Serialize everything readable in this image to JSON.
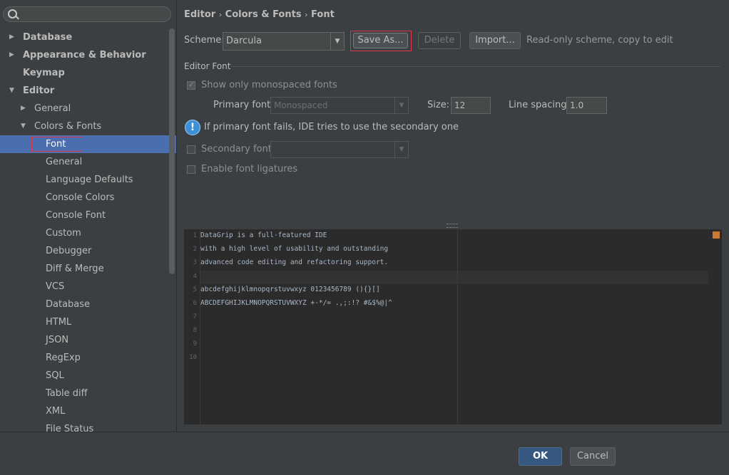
{
  "search": {
    "placeholder": ""
  },
  "sidebar": {
    "items": [
      {
        "label": "Database",
        "level": 0,
        "arrow": "▶",
        "bold": true
      },
      {
        "label": "Appearance & Behavior",
        "level": 0,
        "arrow": "▶",
        "bold": true
      },
      {
        "label": "Keymap",
        "level": 0,
        "arrow": "",
        "bold": true
      },
      {
        "label": "Editor",
        "level": 0,
        "arrow": "▼",
        "bold": true
      },
      {
        "label": "General",
        "level": 1,
        "arrow": "▶"
      },
      {
        "label": "Colors & Fonts",
        "level": 1,
        "arrow": "▼"
      },
      {
        "label": "Font",
        "level": 2,
        "arrow": "",
        "selected": true
      },
      {
        "label": "General",
        "level": 2,
        "arrow": ""
      },
      {
        "label": "Language Defaults",
        "level": 2,
        "arrow": ""
      },
      {
        "label": "Console Colors",
        "level": 2,
        "arrow": ""
      },
      {
        "label": "Console Font",
        "level": 2,
        "arrow": ""
      },
      {
        "label": "Custom",
        "level": 2,
        "arrow": ""
      },
      {
        "label": "Debugger",
        "level": 2,
        "arrow": ""
      },
      {
        "label": "Diff & Merge",
        "level": 2,
        "arrow": ""
      },
      {
        "label": "VCS",
        "level": 2,
        "arrow": ""
      },
      {
        "label": "Database",
        "level": 2,
        "arrow": ""
      },
      {
        "label": "HTML",
        "level": 2,
        "arrow": ""
      },
      {
        "label": "JSON",
        "level": 2,
        "arrow": ""
      },
      {
        "label": "RegExp",
        "level": 2,
        "arrow": ""
      },
      {
        "label": "SQL",
        "level": 2,
        "arrow": ""
      },
      {
        "label": "Table diff",
        "level": 2,
        "arrow": ""
      },
      {
        "label": "XML",
        "level": 2,
        "arrow": ""
      },
      {
        "label": "File Status",
        "level": 2,
        "arrow": ""
      }
    ]
  },
  "breadcrumb": {
    "part1": "Editor",
    "sep1": "›",
    "part2": "Colors & Fonts",
    "sep2": "›",
    "part3": "Font"
  },
  "scheme": {
    "label": "Scheme:",
    "value": "Darcula",
    "save_as": "Save As...",
    "delete": "Delete",
    "import": "Import...",
    "note": "Read-only scheme, copy to edit"
  },
  "editor_font": {
    "section_title": "Editor Font",
    "show_mono_label": "Show only monospaced fonts",
    "show_mono_checked": true,
    "primary_font_label": "Primary font:",
    "primary_font_value": "Monospaced",
    "size_label": "Size:",
    "size_value": "12",
    "line_spacing_label": "Line spacing:",
    "line_spacing_value": "1.0",
    "info_text": "If primary font fails, IDE tries to use the secondary one",
    "secondary_font_label": "Secondary font:",
    "secondary_font_value": "",
    "ligatures_label": "Enable font ligatures"
  },
  "preview": {
    "lines": [
      {
        "num": "1",
        "text": "DataGrip is a full-featured IDE"
      },
      {
        "num": "2",
        "text": "with a high level of usability and outstanding"
      },
      {
        "num": "3",
        "text": "advanced code editing and refactoring support."
      },
      {
        "num": "4",
        "text": ""
      },
      {
        "num": "5",
        "text": "abcdefghijklmnopqrstuvwxyz 0123456789 (){}[]"
      },
      {
        "num": "6",
        "text": "ABCDEFGHIJKLMNOPQRSTUVWXYZ +-*/= .,;:!? #&$%@|^"
      },
      {
        "num": "7",
        "text": ""
      },
      {
        "num": "8",
        "text": ""
      },
      {
        "num": "9",
        "text": ""
      },
      {
        "num": "10",
        "text": ""
      }
    ]
  },
  "footer": {
    "ok": "OK",
    "cancel": "Cancel"
  },
  "colors": {
    "selection": "#4b6eaf",
    "highlight_box": "#e0344b",
    "marker": "#cc7832"
  }
}
